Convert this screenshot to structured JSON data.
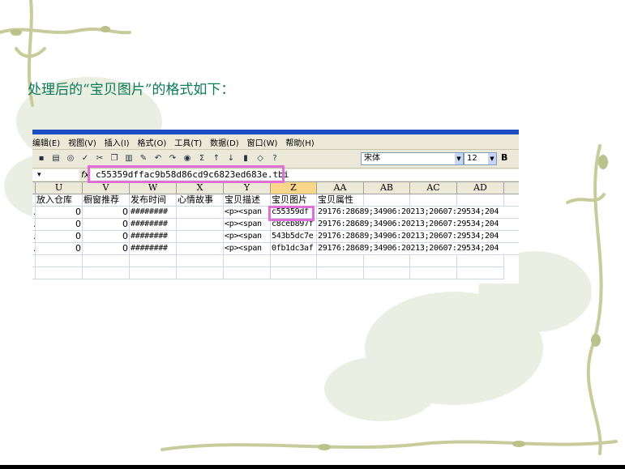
{
  "heading": "处理后的“宝贝图片”的格式如下：",
  "excel": {
    "menu": [
      "编辑(E)",
      "视图(V)",
      "插入(I)",
      "格式(O)",
      "工具(T)",
      "数据(D)",
      "窗口(W)",
      "帮助(H)"
    ],
    "font_name": "宋体",
    "font_size": "12",
    "bold_label": "B",
    "name_box_arrow": "▾",
    "fx_label": "fx",
    "formula_value": "c55359dffac9b58d86cd9c6823ed683e.tbi",
    "columns": [
      "U",
      "V",
      "W",
      "X",
      "Y",
      "Z",
      "AA",
      "AB",
      "AC",
      "AD"
    ],
    "selected_column": "Z",
    "header_row": [
      "放入仓库",
      "橱窗推荐",
      "发布时间",
      "心情故事",
      "宝贝描述",
      "宝贝图片",
      "宝贝属性",
      "",
      "",
      ""
    ],
    "rows": [
      {
        "lead": ".",
        "u": "0",
        "v": "0",
        "w": "########",
        "x": "",
        "y": "<p><span",
        "z": "c55359df",
        "aa": "29176:28689;34906:20213;20607:29534;204"
      },
      {
        "lead": ".",
        "u": "0",
        "v": "0",
        "w": "########",
        "x": "",
        "y": "<p><span",
        "z": "c8ceb897f",
        "aa": "29176:28689;34906:20213;20607:29534;204"
      },
      {
        "lead": ".",
        "u": "0",
        "v": "0",
        "w": "########",
        "x": "",
        "y": "<p><span",
        "z": "543b5dc7e",
        "aa": "29176:28689;34906:20213;20607:29534;204"
      },
      {
        "lead": ".",
        "u": "0",
        "v": "0",
        "w": "########",
        "x": "",
        "y": "<p><span",
        "z": "0fb1dc3af",
        "aa": "29176:28689;34906:20213;20607:29534;204"
      }
    ]
  },
  "colors": {
    "heading": "#0a7a57",
    "highlight": "#e070d8",
    "selected_header": "#fbd68a"
  }
}
